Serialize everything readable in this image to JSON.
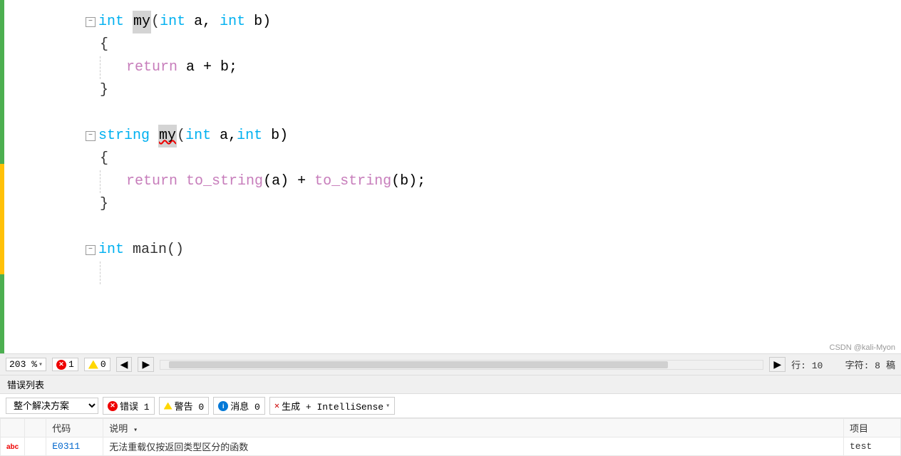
{
  "editor": {
    "zoom": "203 %",
    "errors_count": "1",
    "warnings_count": "0",
    "position": "行: 10",
    "char": "字符: 8",
    "lines": [
      {
        "id": "l1",
        "indent": 0,
        "collapsible": true,
        "content_html": "func1"
      },
      {
        "id": "l2",
        "indent": 1,
        "content_html": "brace_open"
      },
      {
        "id": "l3",
        "indent": 2,
        "content_html": "return_ab"
      },
      {
        "id": "l4",
        "indent": 1,
        "content_html": "brace_close"
      },
      {
        "id": "l5",
        "content_html": "empty"
      },
      {
        "id": "l6",
        "indent": 0,
        "collapsible": true,
        "content_html": "func2"
      },
      {
        "id": "l7",
        "indent": 1,
        "content_html": "brace_open"
      },
      {
        "id": "l8",
        "indent": 2,
        "content_html": "return_tstring"
      },
      {
        "id": "l9",
        "indent": 1,
        "content_html": "brace_close"
      },
      {
        "id": "l10",
        "content_html": "empty"
      },
      {
        "id": "l11",
        "indent": 0,
        "collapsible": true,
        "content_html": "func3"
      },
      {
        "id": "l12",
        "content_html": "partial"
      }
    ]
  },
  "status_bar": {
    "zoom": "203 %",
    "errors": "1",
    "warnings": "0",
    "position": "行: 10",
    "char": "字符: 8"
  },
  "error_panel": {
    "title": "错误列表",
    "scope_label": "整个解决方案",
    "errors_label": "错误 1",
    "warnings_label": "警告 0",
    "messages_label": "消息 0",
    "build_label": "生成 + IntelliSense",
    "columns": {
      "col1": "",
      "code": "代码",
      "description": "说明",
      "project": "项目"
    },
    "rows": [
      {
        "icon": "error",
        "code": "E0311",
        "description": "无法重载仅按返回类型区分的函数",
        "project": "test"
      }
    ]
  },
  "watermark": "CSDN @kali-Myon"
}
